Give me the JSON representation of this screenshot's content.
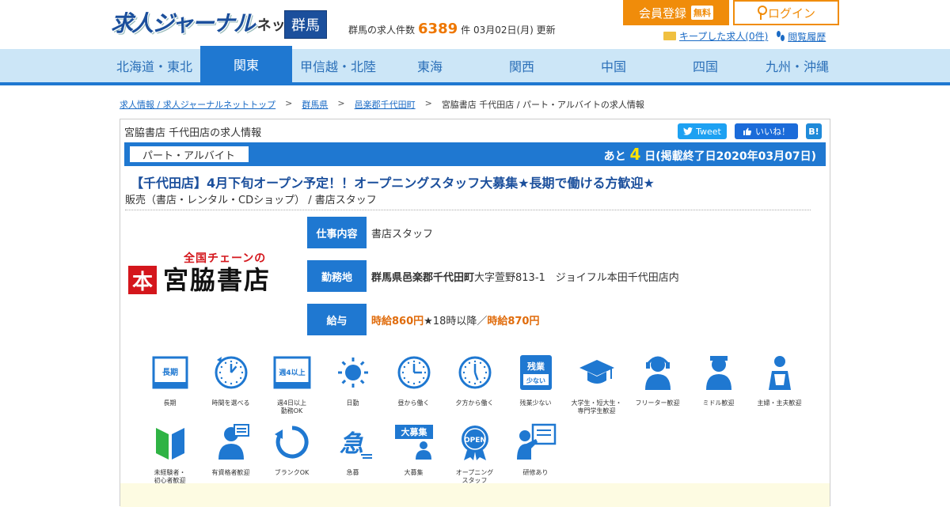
{
  "header": {
    "logo_main": "求人ジャーナル",
    "logo_sub": "ネット",
    "pref_badge": "群馬",
    "count_prefix": "群馬の求人件数",
    "count_value": "6389",
    "count_suffix": "件 03月02日(月) 更新",
    "member_button": "会員登録",
    "free_tag": "無料",
    "login_button": "ログイン",
    "kept_jobs": "キープした求人(0件)",
    "history": "閲覧履歴"
  },
  "nav": {
    "items": [
      "北海道・東北",
      "関東",
      "甲信越・北陸",
      "東海",
      "関西",
      "中国",
      "四国",
      "九州・沖縄"
    ],
    "active_index": 1
  },
  "breadcrumb": {
    "items": [
      {
        "label": "求人情報 / 求人ジャーナルネットトップ",
        "link": true
      },
      {
        "label": "群馬県",
        "link": true
      },
      {
        "label": "邑楽郡千代田町",
        "link": true
      },
      {
        "label": "宮脇書店 千代田店 / パート・アルバイトの求人情報",
        "link": false
      }
    ],
    "separator": ">"
  },
  "job": {
    "heading": "宮脇書店 千代田店の求人情報",
    "share_tweet": "Tweet",
    "share_like": "いいね！",
    "share_hatena": "B!",
    "employment_type": "パート・アルバイト",
    "remain_prefix": "あと",
    "remain_days": "4",
    "remain_suffix": "日(掲載終了日2020年03月07日)",
    "title": "【千代田店】4月下旬オープン予定！！オープニングスタッフ大募集★長期で働ける方歓迎★",
    "category": "販売（書店・レンタル・CDショップ） / 書店スタッフ",
    "company_logo_sub": "全国チェーンの",
    "company_logo_box": "本",
    "company_logo_main": "宮脇書店",
    "work_label": "仕事内容",
    "work_value": "書店スタッフ",
    "place_label": "勤務地",
    "place_bold": "群馬県邑楽郡千代田町",
    "place_rest": "大字萱野813-1　ジョイフル本田千代田店内",
    "salary_label": "給与",
    "salary_1": "時給860円",
    "salary_mid": "★18時以降／",
    "salary_2": "時給870円"
  },
  "features": [
    {
      "icon": "long-term-icon",
      "label": "長期",
      "glyph": "長期"
    },
    {
      "icon": "clock-choose-icon",
      "label": "時間を選べる"
    },
    {
      "icon": "four-days-icon",
      "label": "週4日以上\n勤務OK",
      "glyph": "週4以上"
    },
    {
      "icon": "sun-icon",
      "label": "日勤"
    },
    {
      "icon": "clock-noon-icon",
      "label": "昼から働く"
    },
    {
      "icon": "clock-evening-icon",
      "label": "夕方から働く"
    },
    {
      "icon": "less-overtime-icon",
      "label": "残業少ない",
      "glyph": "残業",
      "glyph2": "少ない"
    },
    {
      "icon": "student-icon",
      "label": "大学生・短大生・\n専門学生歓迎"
    },
    {
      "icon": "freeter-icon",
      "label": "フリーター歓迎"
    },
    {
      "icon": "middle-age-icon",
      "label": "ミドル歓迎"
    },
    {
      "icon": "housewife-icon",
      "label": "主婦・主夫歓迎"
    },
    {
      "icon": "beginner-icon",
      "label": "未経験者・\n初心者歓迎"
    },
    {
      "icon": "qualified-icon",
      "label": "有資格者歓迎"
    },
    {
      "icon": "blank-ok-icon",
      "label": "ブランクOK"
    },
    {
      "icon": "urgent-icon",
      "label": "急募",
      "glyph": "急"
    },
    {
      "icon": "mass-hiring-icon",
      "label": "大募集",
      "glyph": "大募集"
    },
    {
      "icon": "opening-icon",
      "label": "オープニング\nスタッフ",
      "glyph": "OPEN"
    },
    {
      "icon": "training-icon",
      "label": "研修あり"
    }
  ],
  "colors": {
    "brand_blue": "#1f78d1",
    "accent_orange": "#f08c0a",
    "icon_blue": "#1f78d1"
  }
}
